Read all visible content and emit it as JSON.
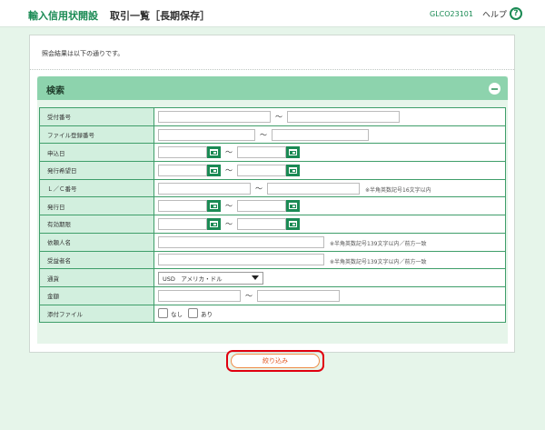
{
  "header": {
    "app_title": "輸入信用状開設",
    "page_title": "取引一覧［長期保存］",
    "screen_id": "GLCO23101",
    "help_label": "ヘルプ",
    "help_icon": "?"
  },
  "message": "照会結果は以下の通りです。",
  "search": {
    "title": "検索",
    "tilde": "～",
    "fields": {
      "receipt_no": "受付番号",
      "file_reg_no": "ファイル登録番号",
      "apply_date": "申込日",
      "issue_request_date": "発行希望日",
      "lc_no": "Ｌ／Ｃ番号",
      "issue_date": "発行日",
      "expiry": "有効期限",
      "applicant": "依頼人名",
      "beneficiary": "受益者名",
      "currency": "通貨",
      "amount": "金額",
      "attachment": "添付ファイル"
    },
    "notes": {
      "lc_no": "※半角英数記号16文字以内",
      "applicant": "※半角英数記号139文字以内／前方一致",
      "beneficiary": "※半角英数記号139文字以内／前方一致"
    },
    "currency_selected": "USD　アメリカ・ドル",
    "attachment_options": {
      "none": "なし",
      "yes": "あり"
    },
    "filter_button": "絞り込み"
  },
  "icons": {
    "help": "help-circle-icon",
    "collapse": "minus-circle-icon",
    "calendar": "calendar-icon",
    "dropdown": "chevron-down-icon"
  },
  "colors": {
    "brand_green": "#1a8a54",
    "header_green": "#8dd3ad",
    "label_bg": "#d2efde",
    "page_bg": "#e6f5ea",
    "highlight_red": "#e0000f",
    "button_orange": "#e0531c"
  }
}
